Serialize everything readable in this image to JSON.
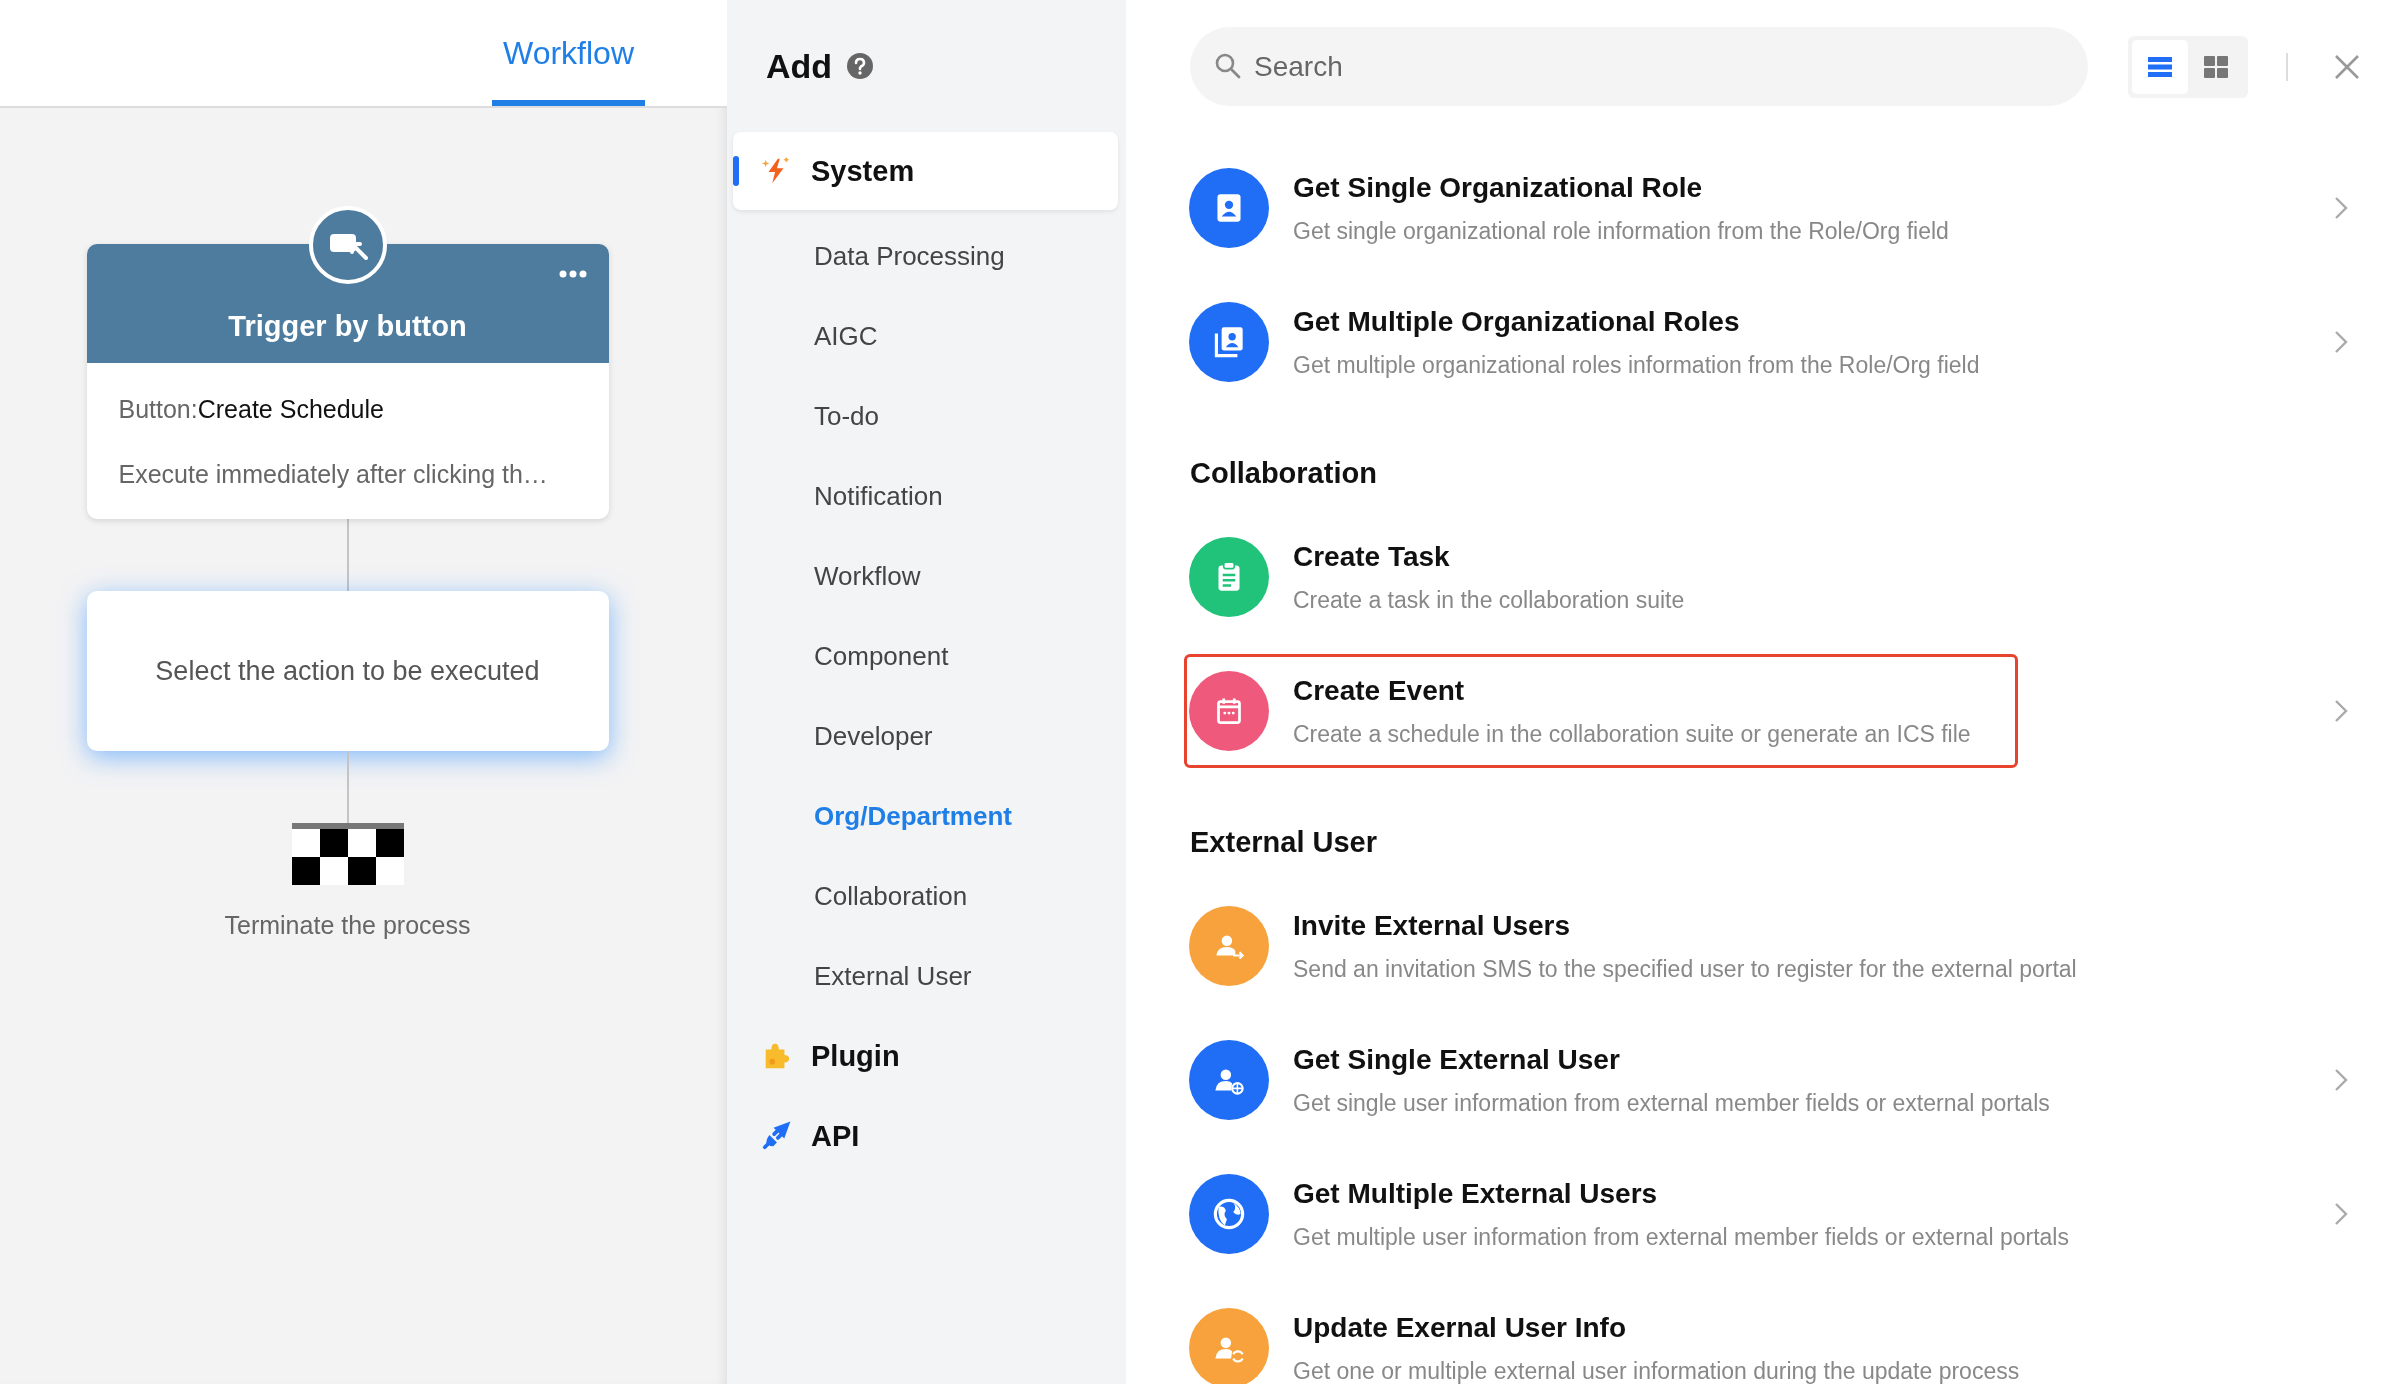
{
  "tabs": [
    {
      "label": "Workflow",
      "selected": true
    }
  ],
  "flow": {
    "trigger": {
      "title": "Trigger by button",
      "button_label": "Button:",
      "button_value": "Create Schedule",
      "description": "Execute immediately after clicking th…"
    },
    "action_placeholder": "Select the action to be executed",
    "end": {
      "label": "Terminate the process"
    }
  },
  "add_panel": {
    "title": "Add",
    "categories": [
      {
        "label": "System",
        "kind": "spark",
        "selected": true,
        "children": [
          {
            "label": "Data Processing",
            "active": false
          },
          {
            "label": "AIGC",
            "active": false
          },
          {
            "label": "To-do",
            "active": false
          },
          {
            "label": "Notification",
            "active": false
          },
          {
            "label": "Workflow",
            "active": false
          },
          {
            "label": "Component",
            "active": false
          },
          {
            "label": "Developer",
            "active": false
          },
          {
            "label": "Org/Department",
            "active": true
          },
          {
            "label": "Collaboration",
            "active": false
          },
          {
            "label": "External User",
            "active": false
          }
        ]
      },
      {
        "label": "Plugin",
        "kind": "puzzle",
        "selected": false
      },
      {
        "label": "API",
        "kind": "plug",
        "selected": false
      }
    ]
  },
  "search": {
    "placeholder": "Search"
  },
  "view_modes": [
    {
      "kind": "list",
      "selected": true
    },
    {
      "kind": "grid",
      "selected": false
    }
  ],
  "sections": [
    {
      "items": [
        {
          "kind": "role",
          "color": "#1f6ef5",
          "title": "Get Single Organizational Role",
          "description": "Get single organizational role information from the Role/Org field",
          "chevron": true,
          "highlighted": false
        },
        {
          "kind": "roles",
          "color": "#1f6ef5",
          "title": "Get Multiple Organizational Roles",
          "description": "Get multiple organizational roles information from the Role/Org field",
          "chevron": true,
          "highlighted": false
        }
      ]
    },
    {
      "heading": "Collaboration",
      "items": [
        {
          "kind": "clipboard",
          "color": "#21c27a",
          "title": "Create Task",
          "description": "Create a task in the collaboration suite",
          "chevron": false,
          "highlighted": false
        },
        {
          "kind": "calendar",
          "color": "#ef5a7c",
          "title": "Create Event",
          "description": "Create a schedule in the collaboration suite or generate an ICS file",
          "chevron": true,
          "highlighted": true
        }
      ]
    },
    {
      "heading": "External User",
      "items": [
        {
          "kind": "user-arrow",
          "color": "#f7a23c",
          "title": "Invite External Users",
          "description": "Send an invitation SMS to the specified user to register for the external portal",
          "chevron": false,
          "highlighted": false
        },
        {
          "kind": "user-globe",
          "color": "#1f6ef5",
          "title": "Get Single External User",
          "description": "Get single user information from external member fields or external portals",
          "chevron": true,
          "highlighted": false
        },
        {
          "kind": "globe",
          "color": "#1f6ef5",
          "title": "Get Multiple External Users",
          "description": "Get multiple user information from external member fields or external portals",
          "chevron": true,
          "highlighted": false
        },
        {
          "kind": "user-sync",
          "color": "#f7a23c",
          "title": "Update Exernal User Info",
          "description": "Get one or multiple external user information during the update process",
          "chevron": false,
          "highlighted": false
        }
      ]
    }
  ]
}
